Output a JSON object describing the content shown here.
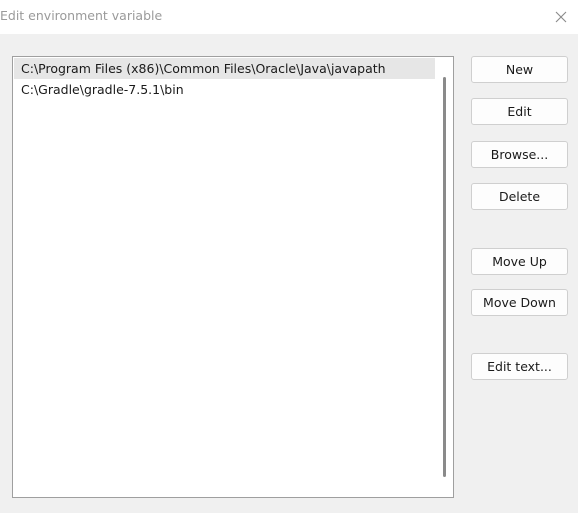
{
  "window": {
    "title": "Edit environment variable",
    "close_icon": "close-icon"
  },
  "list": {
    "items": [
      {
        "label": "C:\\Program Files (x86)\\Common Files\\Oracle\\Java\\javapath",
        "selected": true
      },
      {
        "label": "C:\\Gradle\\gradle-7.5.1\\bin",
        "selected": false
      }
    ]
  },
  "buttons": {
    "new_label": "New",
    "edit_label": "Edit",
    "browse_label": "Browse...",
    "delete_label": "Delete",
    "move_up_label": "Move Up",
    "move_down_label": "Move Down",
    "edit_text_label": "Edit text..."
  },
  "colors": {
    "dialog_bg": "#f0f0f0",
    "selection": "#e6e6e6",
    "title_text": "#9a9a9a"
  }
}
